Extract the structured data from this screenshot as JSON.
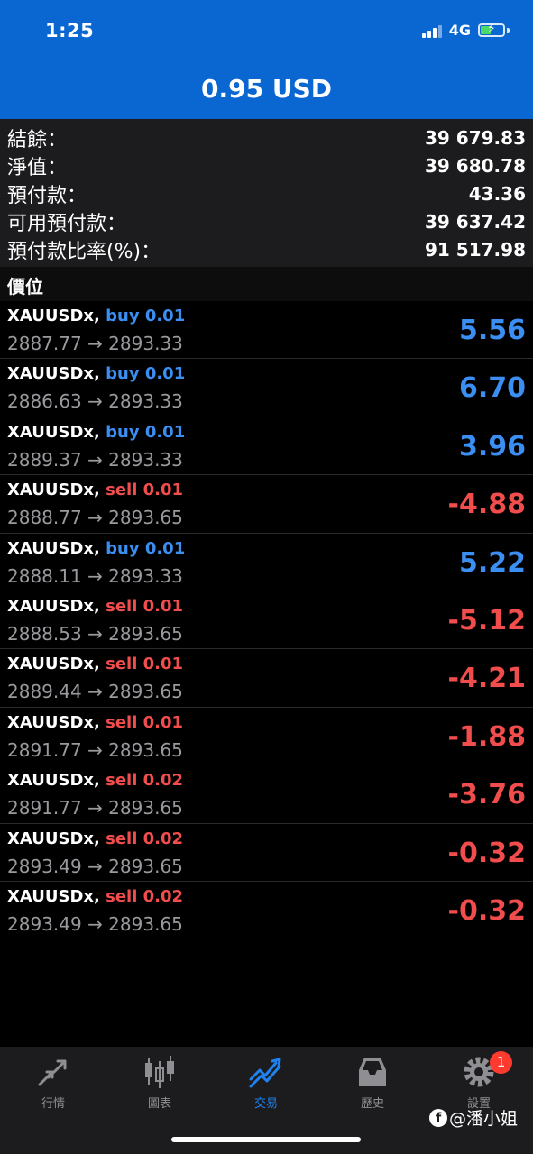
{
  "status_bar": {
    "time": "1:25",
    "network": "4G"
  },
  "header": {
    "title": "0.95 USD"
  },
  "summary": [
    {
      "label": "結餘：",
      "value": "39 679.83"
    },
    {
      "label": "淨值：",
      "value": "39 680.78"
    },
    {
      "label": "預付款：",
      "value": "43.36"
    },
    {
      "label": "可用預付款：",
      "value": "39 637.42"
    },
    {
      "label": "預付款比率(%)：",
      "value": "91 517.98"
    }
  ],
  "section_title": "價位",
  "positions": [
    {
      "symbol": "XAUUSDx,",
      "direction": "buy 0.01",
      "prices": "2887.77 → 2893.33",
      "profit": "5.56",
      "side": "buy"
    },
    {
      "symbol": "XAUUSDx,",
      "direction": "buy 0.01",
      "prices": "2886.63 → 2893.33",
      "profit": "6.70",
      "side": "buy"
    },
    {
      "symbol": "XAUUSDx,",
      "direction": "buy 0.01",
      "prices": "2889.37 → 2893.33",
      "profit": "3.96",
      "side": "buy"
    },
    {
      "symbol": "XAUUSDx,",
      "direction": "sell 0.01",
      "prices": "2888.77 → 2893.65",
      "profit": "-4.88",
      "side": "sell"
    },
    {
      "symbol": "XAUUSDx,",
      "direction": "buy 0.01",
      "prices": "2888.11 → 2893.33",
      "profit": "5.22",
      "side": "buy"
    },
    {
      "symbol": "XAUUSDx,",
      "direction": "sell 0.01",
      "prices": "2888.53 → 2893.65",
      "profit": "-5.12",
      "side": "sell"
    },
    {
      "symbol": "XAUUSDx,",
      "direction": "sell 0.01",
      "prices": "2889.44 → 2893.65",
      "profit": "-4.21",
      "side": "sell"
    },
    {
      "symbol": "XAUUSDx,",
      "direction": "sell 0.01",
      "prices": "2891.77 → 2893.65",
      "profit": "-1.88",
      "side": "sell"
    },
    {
      "symbol": "XAUUSDx,",
      "direction": "sell 0.02",
      "prices": "2891.77 → 2893.65",
      "profit": "-3.76",
      "side": "sell"
    },
    {
      "symbol": "XAUUSDx,",
      "direction": "sell 0.02",
      "prices": "2893.49 → 2893.65",
      "profit": "-0.32",
      "side": "sell"
    },
    {
      "symbol": "XAUUSDx,",
      "direction": "sell 0.02",
      "prices": "2893.49 → 2893.65",
      "profit": "-0.32",
      "side": "sell"
    }
  ],
  "tabs": [
    {
      "label": "行情",
      "icon": "quotes-arrows-icon"
    },
    {
      "label": "圖表",
      "icon": "candlestick-chart-icon"
    },
    {
      "label": "交易",
      "icon": "trade-trend-icon",
      "active": true
    },
    {
      "label": "歷史",
      "icon": "history-inbox-icon"
    },
    {
      "label": "設置",
      "icon": "settings-gear-icon",
      "badge": "1"
    }
  ],
  "watermark": "@潘小姐",
  "colors": {
    "header": "#0a66d0",
    "buy": "#3b8ef2",
    "sell": "#f24d4d",
    "background": "#000000"
  }
}
